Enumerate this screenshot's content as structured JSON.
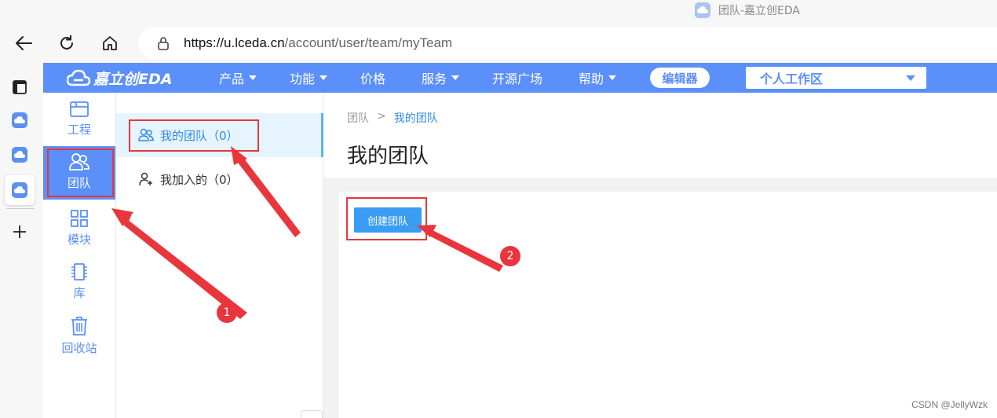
{
  "browser": {
    "tab_title": "团队-嘉立创EDA",
    "url_host": "https://u.lceda.cn",
    "url_path": "/account/user/team/myTeam"
  },
  "app": {
    "logo_text": "嘉立创EDA",
    "menu": [
      {
        "label": "产品",
        "has_dropdown": true
      },
      {
        "label": "功能",
        "has_dropdown": true
      },
      {
        "label": "价格",
        "has_dropdown": false
      },
      {
        "label": "服务",
        "has_dropdown": true
      },
      {
        "label": "开源广场",
        "has_dropdown": false
      },
      {
        "label": "帮助",
        "has_dropdown": true
      }
    ],
    "editor_button": "编辑器",
    "workspace_select": "个人工作区",
    "brand_color": "#5b8ff9"
  },
  "sidebar": {
    "items": [
      {
        "label": "工程",
        "icon": "folder-icon"
      },
      {
        "label": "团队",
        "icon": "team-icon",
        "active": true
      },
      {
        "label": "模块",
        "icon": "grid-icon"
      },
      {
        "label": "库",
        "icon": "chip-icon"
      },
      {
        "label": "回收站",
        "icon": "trash-icon"
      }
    ]
  },
  "submenu": {
    "items": [
      {
        "label": "我的团队（0）",
        "icon": "team-icon",
        "active": true
      },
      {
        "label": "我加入的（0）",
        "icon": "user-add-icon"
      }
    ]
  },
  "main": {
    "breadcrumb": [
      "团队",
      ">",
      "我的团队"
    ],
    "title": "我的团队",
    "create_button": "创建团队"
  },
  "annotations": {
    "badge_1": "1",
    "badge_2": "2",
    "color": "#e8363c"
  },
  "watermark": "CSDN @JellyWzk"
}
